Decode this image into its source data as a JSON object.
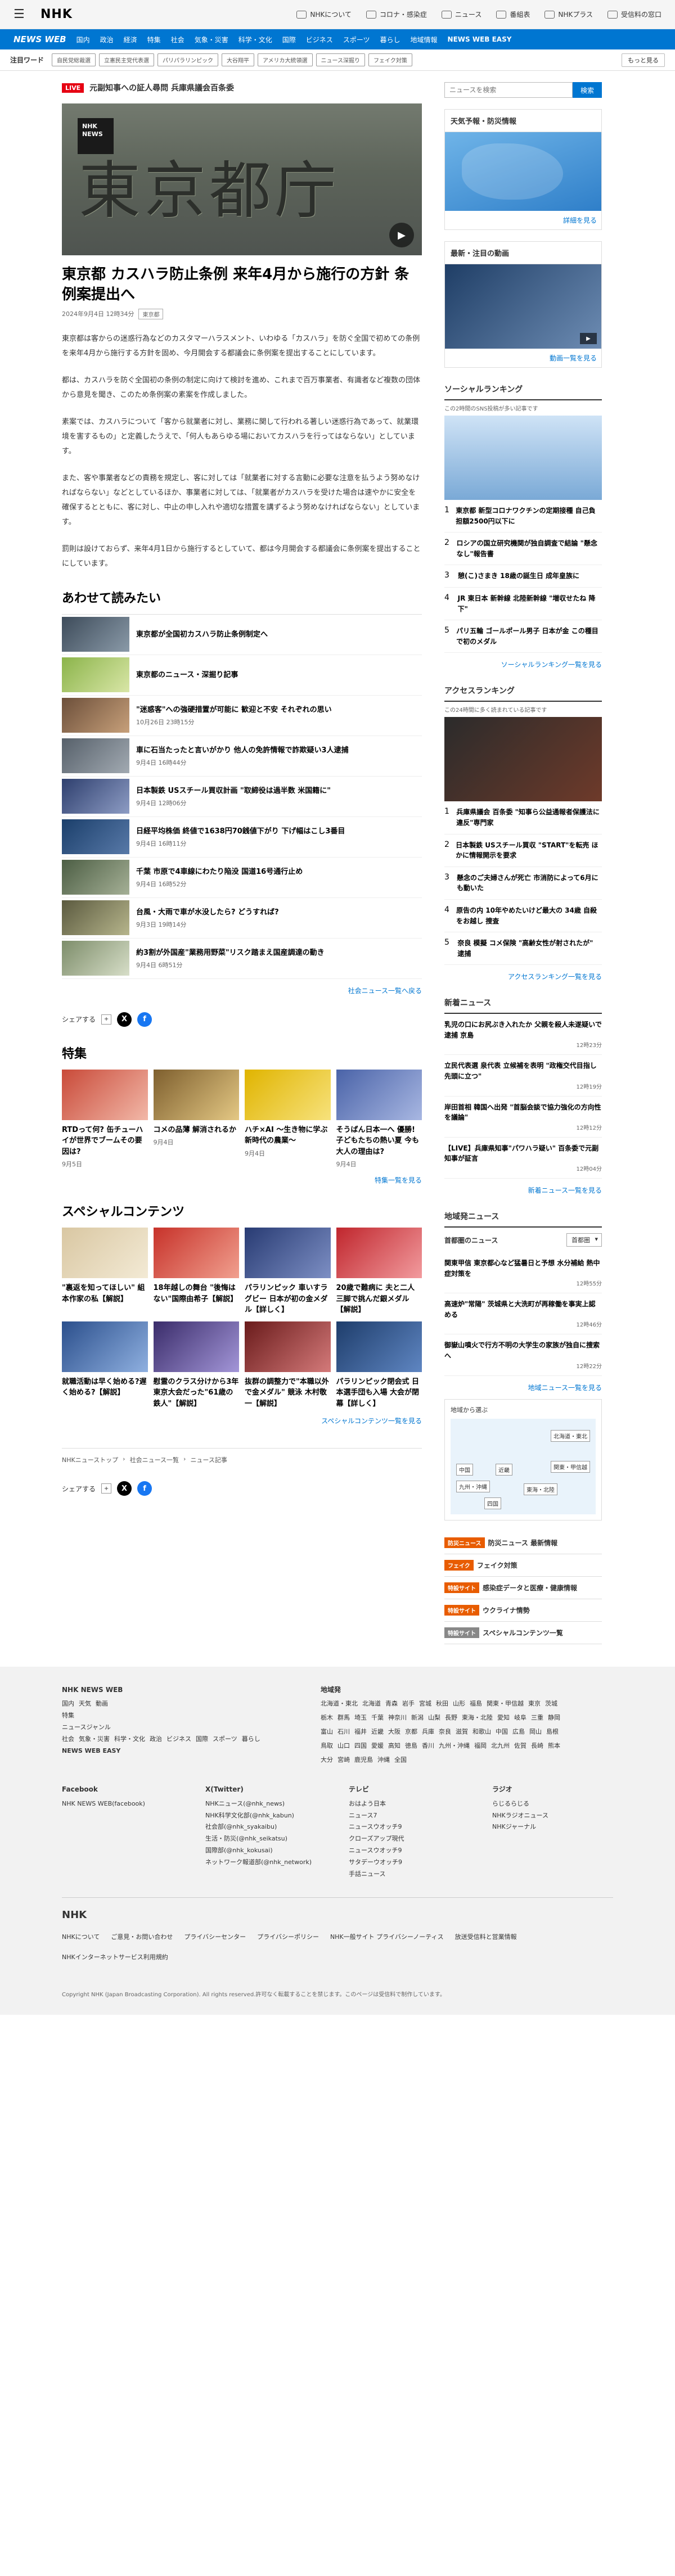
{
  "topbar": {
    "logo": "NHK",
    "links": [
      "NHKについて",
      "コロナ・感染症",
      "ニュース",
      "番組表",
      "NHKプラス",
      "受信料の窓口"
    ]
  },
  "bluebar": {
    "brand": "NEWS WEB",
    "items": [
      "国内",
      "政治",
      "経済",
      "特集",
      "社会",
      "気象・災害",
      "科学・文化",
      "国際",
      "ビジネス",
      "国際",
      "スポーツ",
      "暮らし",
      "地域情報 ",
      "NEWS WEB EASY"
    ]
  },
  "keywords": {
    "label": "注目ワード",
    "tags": [
      "自民党総裁選",
      "立憲民主党代表選",
      "パリパラリンピック",
      "大谷翔平",
      "アメリカ大統領選",
      "ニュース深掘り",
      "フェイク対策"
    ],
    "more": "もっと見る"
  },
  "article": {
    "live_badge": "LIVE",
    "live_title": "元副知事への証人尋問 兵庫県議会百条委",
    "hero_kanji": "東京都庁",
    "hero_logo": "NHK NEWS",
    "title": "東京都 カスハラ防止条例 来年4月から施行の方針 条例案提出へ",
    "date": "2024年9月4日 12時34分",
    "category": "東京都",
    "paragraphs": [
      "東京都は客からの迷惑行為などのカスタマーハラスメント、いわゆる「カスハラ」を防ぐ全国で初めての条例を来年4月から施行する方針を固め、今月開会する都議会に条例案を提出することにしています。",
      "都は、カスハラを防ぐ全国初の条例の制定に向けて検討を進め、これまで百万事業者、有識者など複数の団体から意見を聞き、このため条例案の素案を作成しました。",
      "素案では、カスハラについて「客から就業者に対し、業務に関して行われる著しい迷惑行為であって、就業環境を害するもの」と定義したうえで、「何人もあらゆる場においてカスハラを行ってはならない」としています。",
      "また、客や事業者などの責務を規定し、客に対しては「就業者に対する言動に必要な注意を払うよう努めなければならない」などとしているほか、事業者に対しては、「就業者がカスハラを受けた場合は速やかに安全を確保するとともに、客に対し、中止の申し入れや適切な措置を講ずるよう努めなければならない」としています。",
      "罰則は設けておらず、来年4月1日から施行するとしていて、都は今月開会する都議会に条例案を提出することにしています。"
    ]
  },
  "related": {
    "heading": "あわせて読みたい",
    "items": [
      {
        "title": "東京都が全国初カスハラ防止条例制定へ",
        "date": ""
      },
      {
        "title": "東京都のニュース・深掘り記事",
        "date": ""
      },
      {
        "title": "\"迷惑客\"への強硬措置が可能に 歓迎と不安 それぞれの思い",
        "date": "10月26日 23時15分"
      },
      {
        "title": "車に石当たったと言いがかり 他人の免許情報で詐欺疑い3人逮捕",
        "date": "9月4日 16時44分"
      },
      {
        "title": "日本製鉄 USスチール買収計画 \"取締役は過半数 米国籍に\"",
        "date": "9月4日 12時06分"
      },
      {
        "title": "日経平均株価 終値で1638円70銭値下がり 下げ幅はこし3番目",
        "date": "9月4日 16時11分"
      },
      {
        "title": "千葉 市原で4車線にわたり陥没 国道16号通行止め",
        "date": "9月4日 16時52分"
      },
      {
        "title": "台風・大雨で車が水没したら? どうすれば?",
        "date": "9月3日 19時14分"
      },
      {
        "title": "約3割が外国産\"業務用野菜\"リスク踏まえ国産調達の動き",
        "date": "9月4日 6時51分"
      }
    ],
    "more": "社会ニュース一覧へ戻る"
  },
  "share": {
    "label": "シェアする"
  },
  "features": {
    "heading": "特集",
    "items": [
      {
        "title": "RTDって何? 缶チューハイが世界でブームその要因は?",
        "date": "9月5日"
      },
      {
        "title": "コメの品薄 解消されるか",
        "date": "9月4日"
      },
      {
        "title": "ハチ×AI 〜生き物に学ぶ新時代の農業〜",
        "date": "9月4日"
      },
      {
        "title": "そうばん日本一へ 優勝!子どもたちの熱い夏 今も大人の理由は?",
        "date": "9月4日"
      }
    ],
    "more": "特集一覧を見る"
  },
  "special": {
    "heading": "スペシャルコンテンツ",
    "items": [
      {
        "title": "\"裏返を知ってほしい\" 組本作家の私【解説】"
      },
      {
        "title": "18年越しの舞台 \"後悔はない\"国際由希子【解説】"
      },
      {
        "title": "パラリンピック 車いすラグビー 日本が初の金メダル【詳しく】"
      },
      {
        "title": "20歳で難病に 夫と二人三脚で挑んだ銀メダル【解説】"
      },
      {
        "title": "就職活動は早く始める?遅く始める?【解説】"
      },
      {
        "title": "慰霊のクラス分けから3年 東京大会だった\"61歳の鉄人\"【解説】"
      },
      {
        "title": "抜群の調整力で\"本職以外で金メダル\" 競泳 木村敬一【解説】"
      },
      {
        "title": "パラリンピック閉会式 日本選手団も入場 大会が閉幕【詳しく】"
      }
    ],
    "more": "スペシャルコンテンツ一覧を見る"
  },
  "breadcrumb": [
    "NHKニューストップ",
    "社会ニュース一覧",
    "ニュース記事"
  ],
  "sidebar": {
    "search_placeholder": "ニュースを検索",
    "search_button": "検索",
    "weather": {
      "title": "天気予報・防災情報",
      "more": "詳細を見る"
    },
    "video": {
      "title": "最新・注目の動画",
      "more": "動画一覧を見る"
    },
    "social": {
      "title": "ソーシャルランキング",
      "sub": "この2時間のSNS投稿が多い記事です",
      "items": [
        "東京都 新型コロナワクチンの定期接種 自己負担額2500円以下に",
        "ロシアの国立研究機関が独自調査で結論 \"懸念なし\"報告書",
        "憩(こ)さまき 18歳の誕生日 成年皇族に",
        "JR 東日本 新幹線 北陸新幹線 \"増収せたね 降下\"",
        "パリ五輪 ゴールポール男子 日本が金 この種目で初のメダル"
      ],
      "more": "ソーシャルランキング一覧を見る"
    },
    "access": {
      "title": "アクセスランキング",
      "sub": "この24時間に多く読まれている記事です",
      "items": [
        "兵庫県議会 百条委 \"知事ら公益通報者保護法に違反\"専門家",
        "日本製鉄 USスチール買収 \"START\"を転売 ほかに情報開示を要求",
        "懸念のご夫婦さんが死亡 市消防によって6月にも動いた",
        "原告の内 10年やめたいけど最大の 34歳 自殺をお越し 捜査",
        "奈良 模擬 コメ保険 \"高齢女性が射されたが\" 逮捕"
      ],
      "more": "アクセスランキング一覧を見る"
    },
    "latest": {
      "title": "新着ニュース",
      "items": [
        {
          "title": "乳児の口にお尻ぶき入れたか 父親を殺人未遂疑いで逮捕 京島",
          "date": "12時23分"
        },
        {
          "title": "立民代表選 泉代表 立候補を表明 \"政権交代目指し先頭に立つ\"",
          "date": "12時19分"
        },
        {
          "title": "岸田首相 韓国へ出発 \"首脳会談で協力強化の方向性を議論\"",
          "date": "12時12分"
        },
        {
          "title": "【LIVE】兵庫県知事\"パワハラ疑い\" 百条委で元副知事が証言",
          "date": "12時04分"
        }
      ],
      "more": "新着ニュース一覧を見る"
    },
    "local": {
      "title": "地域発ニュース",
      "subtitle": "首都圏のニュース",
      "select": "首都圏",
      "items": [
        {
          "title": "関東甲信 東京都心など猛暑日と予想 水分補給 熱中症対策を",
          "date": "12時55分"
        },
        {
          "title": "高速炉\"常陽\" 茨城県と大洗町が再稼働を事実上認める",
          "date": "12時46分"
        },
        {
          "title": "御嶽山噴火で行方不明の大学生の家族が独自に捜索へ",
          "date": "12時22分"
        }
      ],
      "more": "地域ニュース一覧を見る",
      "map_title": "地域から選ぶ",
      "regions": [
        "北海道・東北",
        "中国",
        "近畿",
        "関東・甲信越",
        "九州・沖縄",
        "四国",
        "東海・北陸"
      ]
    },
    "links": [
      {
        "badge": "防災ニュース",
        "text": "防災ニュース 最新情報",
        "color": "#e85c00"
      },
      {
        "badge": "フェイク",
        "text": "フェイク対策",
        "color": "#e85c00"
      },
      {
        "badge": "特設サイト",
        "text": "感染症データと医療・健康情報",
        "color": "#e85c00"
      },
      {
        "badge": "特設サイト",
        "text": "ウクライナ情勢",
        "color": "#e85c00"
      },
      {
        "badge": "特設サイト",
        "text": "スペシャルコンテンツ一覧",
        "color": "#888888"
      }
    ]
  },
  "footer": {
    "site": "NHK NEWS WEB",
    "cols": [
      [
        "NHK NEWS WEB",
        "国内",
        "天気",
        "動画",
        "特集",
        "ニュースジャンル",
        "社会",
        "気象・災害",
        "科学・文化",
        "政治",
        "ビジネス",
        "国際",
        "スポーツ",
        "暮らし",
        "NEWS WEB EASY"
      ],
      [
        "地域発",
        "北海道・東北",
        "北海道",
        "青森",
        "岩手",
        "宮城",
        "秋田",
        "山形",
        "福島",
        "関東・甲信越",
        "東京",
        "茨城",
        "栃木",
        "群馬",
        "埼玉",
        "千葉",
        "神奈川",
        "新潟",
        "山梨",
        "長野",
        "東海・北陸",
        "愛知",
        "岐阜",
        "三重",
        "静岡",
        "富山",
        "石川",
        "福井",
        "近畿",
        "大阪",
        "京都",
        "兵庫",
        "奈良",
        "滋賀",
        "和歌山",
        "中国",
        "広島",
        "岡山",
        "島根",
        "鳥取",
        "山口",
        "四国",
        "愛媛",
        "高知",
        "徳島",
        "香川",
        "九州・沖縄",
        "福岡",
        "北九州",
        "佐賀",
        "長崎",
        "熊本",
        "大分",
        "宮崎",
        "鹿児島",
        "沖縄",
        "全国"
      ],
      [
        "Facebook",
        "NHK NEWS WEB(facebook)"
      ],
      [
        "X(Twitter)",
        "NHKニュース(@nhk_news)",
        "NHK科学文化部(@nhk_kabun)",
        "社会部(@nhk_syakaibu)",
        "生活・防災(@nhk_seikatsu)",
        "国際部(@nhk_kokusai)",
        "ネットワーク報道部(@nhk_network)"
      ],
      [
        "テレビ",
        "おはよう日本",
        "ニュース7",
        "ニュースウオッチ9",
        "クローズアップ現代",
        "ニュースウオッチ9",
        "サタデーウオッチ9",
        "手話ニュース"
      ],
      [
        "ラジオ",
        "らじるらじる",
        "NHKラジオニュース",
        "NHKジャーナル"
      ]
    ],
    "bottom_links": [
      "NHKについて",
      "ご意見・お問い合わせ",
      "プライバシーセンター",
      "プライバシーポリシー",
      "NHK一般サイト プライバシーノーティス",
      "放送受信料と営業情報",
      "NHKインターネットサービス利用規約"
    ],
    "copyright": "Copyright NHK (Japan Broadcasting Corporation). All rights reserved.許可なく転載することを禁じます。このページは受信料で制作しています。"
  }
}
